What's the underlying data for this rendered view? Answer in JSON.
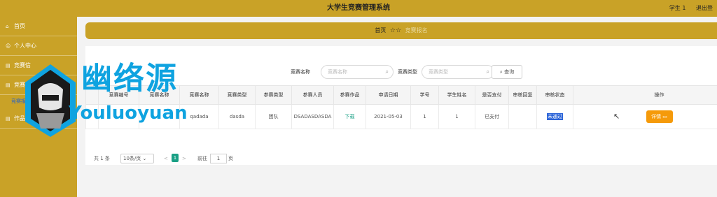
{
  "header": {
    "title": "大学生竞赛管理系统",
    "user": "学生 1",
    "logout": "退出登"
  },
  "sidebar": {
    "items": [
      {
        "label": "首页"
      },
      {
        "label": "个人中心"
      },
      {
        "label": "竞赛信"
      },
      {
        "label": "竞赛报"
      },
      {
        "label": "作品打分管理"
      }
    ],
    "sub_item": "竞赛报名"
  },
  "breadcrumb": {
    "home": "首页",
    "stars": "☆☆",
    "current": "竞赛报名"
  },
  "search": {
    "name_label": "竞赛名称",
    "name_placeholder": "竞赛名称",
    "type_label": "竞赛类型",
    "type_placeholder": "竞赛类型",
    "button": "查询"
  },
  "table": {
    "headers": [
      "",
      "竞赛编号",
      "竞赛名称",
      "竞赛名称",
      "竞赛类型",
      "参赛类型",
      "参赛人员",
      "参赛作品",
      "申请日期",
      "学号",
      "学生姓名",
      "是否支付",
      "审核回复",
      "审核状态",
      "操作"
    ],
    "rows": [
      {
        "cells": [
          "",
          "",
          "",
          "qadada",
          "dasda",
          "团队",
          "DSADASDASDA",
          "下载",
          "2021-05-03",
          "1",
          "1",
          "已支付",
          "",
          "未通过",
          "详情"
        ]
      }
    ]
  },
  "pager": {
    "total": "共 1 条",
    "page_size": "10条/页",
    "prev": "<",
    "page": "1",
    "next": ">",
    "goto": "前往",
    "goto_value": "1",
    "page_unit": "页"
  },
  "watermark": {
    "text": "幽络源",
    "sub": "Youluoyuan"
  },
  "colors": {
    "theme": "#c9a227",
    "accent": "#1aa085",
    "button_orange": "#f59a0a",
    "watermark": "#0fa3e0"
  }
}
